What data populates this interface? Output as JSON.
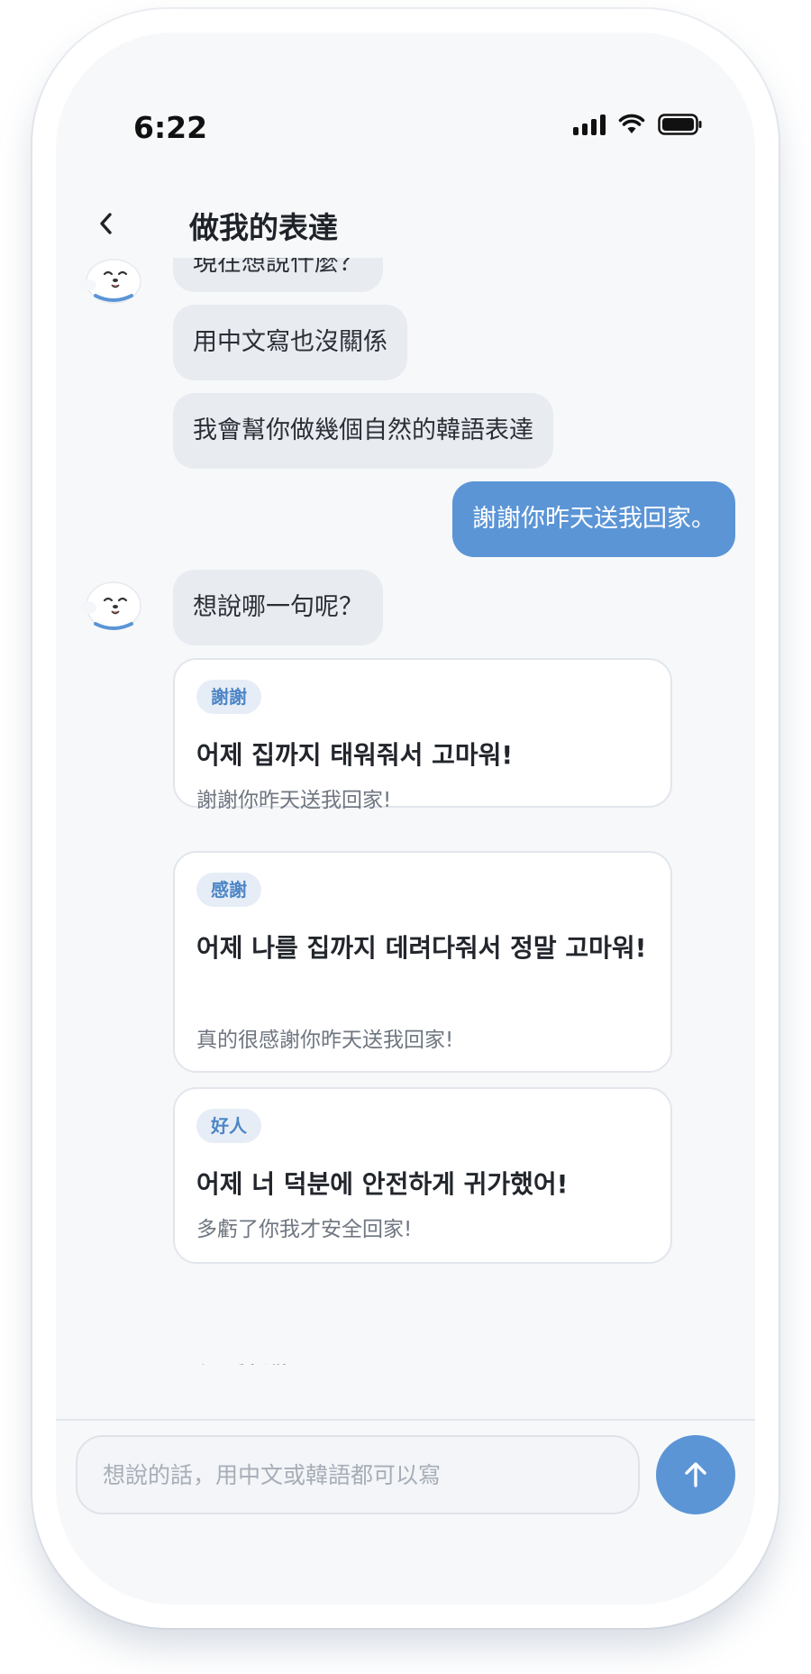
{
  "status_bar": {
    "time": "6:22"
  },
  "header": {
    "title": "做我的表達"
  },
  "messages": {
    "bot_1": "現在想說什麼？",
    "bot_2": "用中文寫也沒關係",
    "bot_3": "我會幫你做幾個自然的韓語表達",
    "user_1": "謝謝你昨天送我回家。",
    "bot_4": "想說哪一句呢？"
  },
  "options": [
    {
      "tag": "謝謝",
      "korean": "어제 집까지 태워줘서 고마워!",
      "chinese": "謝謝你昨天送我回家!"
    },
    {
      "tag": "感謝",
      "korean": "어제 나를 집까지 데려다줘서 정말 고마워!",
      "chinese": "真的很感謝你昨天送我回家!"
    },
    {
      "tag": "好人",
      "korean": "어제 너 덕분에 안전하게 귀가했어!",
      "chinese": "多虧了你我才安全回家!"
    }
  ],
  "redo": {
    "label": "重新做"
  },
  "composer": {
    "placeholder": "想說的話，用中文或韓語都可以寫"
  },
  "colors": {
    "accent": "#5b95d6",
    "bot_bubble": "#e8ebf0",
    "tag_bg": "#e6edf6"
  },
  "icons": {
    "back": "chevron-left-icon",
    "signal": "cellular-signal-icon",
    "wifi": "wifi-icon",
    "battery": "battery-icon",
    "avatar": "seal-mascot-avatar",
    "redo": "refresh-icon",
    "send": "arrow-up-icon"
  }
}
